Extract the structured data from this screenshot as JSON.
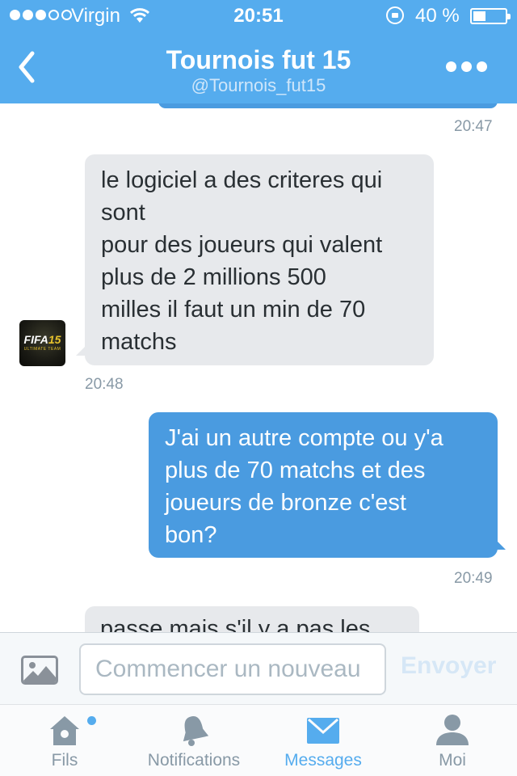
{
  "status_bar": {
    "carrier": "Virgin",
    "time": "20:51",
    "battery_percent": "40 %",
    "battery_level": 0.4,
    "signal_bars_filled": 3,
    "signal_bars_total": 5
  },
  "header": {
    "title": "Tournois fut 15",
    "handle": "@Tournois_fut15",
    "back_icon": "chevron-left-icon",
    "more_icon": "ellipsis-icon"
  },
  "messages": [
    {
      "direction": "out",
      "partial": true,
      "time": "20:47"
    },
    {
      "direction": "in",
      "lines": [
        "le logiciel a des criteres qui",
        "sont",
        "pour des joueurs qui valent",
        "plus de 2 millions 500",
        "milles il faut un min de 70",
        "matchs"
      ],
      "time": "20:48"
    },
    {
      "direction": "out",
      "lines": [
        "J'ai un autre compte ou y'a",
        "plus de 70 matchs et des",
        "joueurs de bronze c'est",
        "bon?"
      ],
      "time": "20:49"
    },
    {
      "direction": "in",
      "partial": true,
      "partial_text": "passe mais s'il y a pas les"
    }
  ],
  "avatar": {
    "logo_text": "FIFA",
    "logo_number": "15",
    "logo_sub": "ULTIMATE TEAM"
  },
  "composer": {
    "placeholder": "Commencer un nouveau",
    "send_label": "Envoyer",
    "photo_icon": "image-icon"
  },
  "tabs": [
    {
      "label": "Fils",
      "icon": "home-icon",
      "active": false,
      "has_dot": true
    },
    {
      "label": "Notifications",
      "icon": "bell-icon",
      "active": false
    },
    {
      "label": "Messages",
      "icon": "envelope-icon",
      "active": true
    },
    {
      "label": "Moi",
      "icon": "person-icon",
      "active": false
    }
  ],
  "colors": {
    "brand": "#55acee",
    "outgoing_bubble": "#4a9be0",
    "incoming_bubble": "#e7e9ec",
    "timestamp": "#8899a6"
  }
}
